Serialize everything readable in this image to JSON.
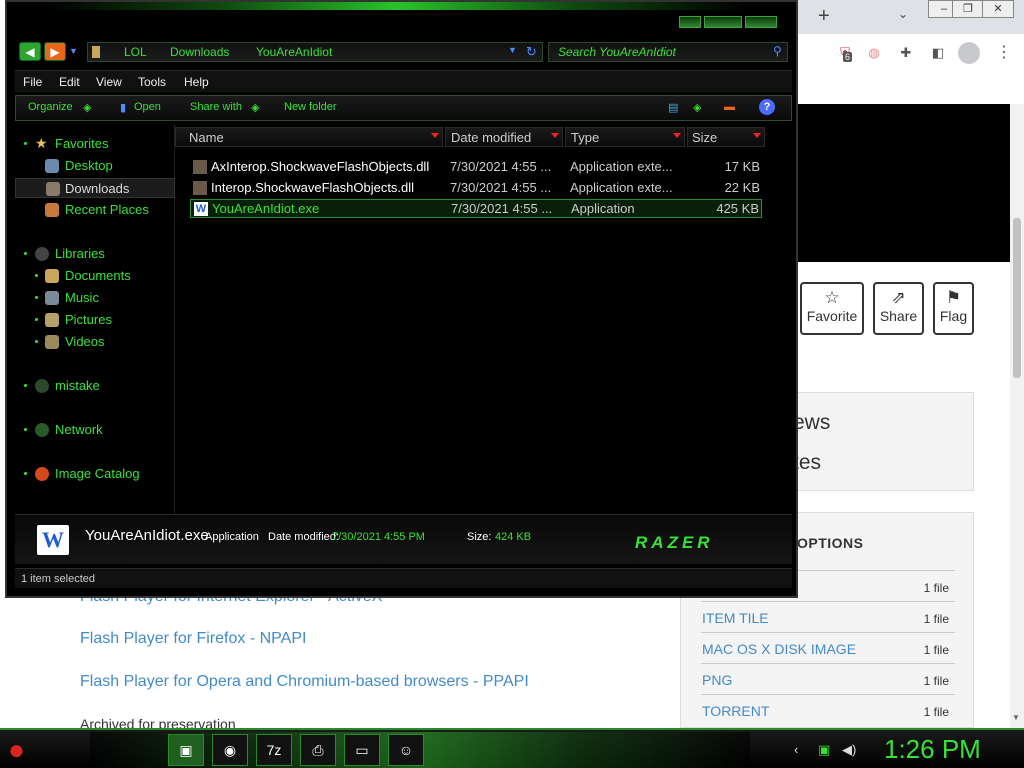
{
  "browser": {
    "new_tab_symbol": "+",
    "tab_menu_symbol": "⌄",
    "badge_count": "6",
    "actions": [
      {
        "label": "Favorite",
        "icon": "star-icon"
      },
      {
        "label": "Share",
        "icon": "share-icon"
      },
      {
        "label": "Flag",
        "icon": "flag-icon"
      }
    ],
    "views_text": "ews",
    "reviews_text": "tes",
    "download_options_title": "OPTIONS",
    "download_options": [
      {
        "type": "",
        "count": "1 file"
      },
      {
        "type": "ITEM TILE",
        "count": "1 file"
      },
      {
        "type": "MAC OS X DISK IMAGE",
        "count": "1 file"
      },
      {
        "type": "PNG",
        "count": "1 file"
      },
      {
        "type": "TORRENT",
        "count": "1 file"
      }
    ],
    "links": [
      "Flash Player for Internet Explorer - ActiveX",
      "Flash Player for Firefox - NPAPI",
      "Flash Player for Opera and Chromium-based browsers - PPAPI"
    ],
    "archived_text": "Archived for preservation",
    "accent": "#428bca"
  },
  "explorer": {
    "breadcrumbs": [
      "LOL",
      "Downloads",
      "YouAreAnIdiot"
    ],
    "search_placeholder": "Search YouAreAnIdiot",
    "menu": [
      "File",
      "Edit",
      "View",
      "Tools",
      "Help"
    ],
    "commands": [
      "Organize",
      "Open",
      "Share with",
      "New folder"
    ],
    "sidebar": {
      "favorites": "Favorites",
      "favorites_items": [
        "Desktop",
        "Downloads",
        "Recent Places"
      ],
      "libraries": "Libraries",
      "library_items": [
        "Documents",
        "Music",
        "Pictures",
        "Videos"
      ],
      "mistake": "mistake",
      "network": "Network",
      "image_catalog": "Image Catalog"
    },
    "columns": [
      "Name",
      "Date modified",
      "Type",
      "Size"
    ],
    "files": [
      {
        "name": "AxInterop.ShockwaveFlashObjects.dll",
        "date": "7/30/2021 4:55 ...",
        "type": "Application exte...",
        "size": "17 KB"
      },
      {
        "name": "Interop.ShockwaveFlashObjects.dll",
        "date": "7/30/2021 4:55 ...",
        "type": "Application exte...",
        "size": "22 KB"
      },
      {
        "name": "YouAreAnIdiot.exe",
        "date": "7/30/2021 4:55 ...",
        "type": "Application",
        "size": "425 KB"
      }
    ],
    "details": {
      "icon_letter": "W",
      "name": "YouAreAnIdiot.exe",
      "type": "Application",
      "date_label": "Date modified:",
      "date_value": "7/30/2021 4:55 PM",
      "size_label": "Size:",
      "size_value": "424 KB",
      "brand": "RAZER"
    },
    "status": "1 item selected",
    "accent": "#37e237"
  },
  "taskbar": {
    "apps": [
      {
        "name": "explorer",
        "icon": "folder-icon",
        "glyph": "▣"
      },
      {
        "name": "chrome",
        "icon": "chrome-icon",
        "glyph": "◉"
      },
      {
        "name": "7zip",
        "icon": "7zip-icon",
        "glyph": "7z"
      },
      {
        "name": "network",
        "icon": "network-icon",
        "glyph": "⎙"
      },
      {
        "name": "window",
        "icon": "window-icon",
        "glyph": "▭"
      },
      {
        "name": "smiley",
        "icon": "smiley-icon",
        "glyph": "☺"
      }
    ],
    "clock": "1:26 PM"
  }
}
